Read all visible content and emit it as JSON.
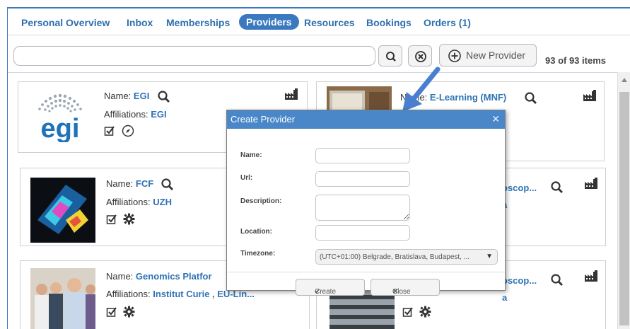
{
  "nav": {
    "tabs": [
      {
        "label": "Personal Overview"
      },
      {
        "label": "Inbox"
      },
      {
        "label": "Memberships"
      },
      {
        "label": "Providers"
      },
      {
        "label": "Resources"
      },
      {
        "label": "Bookings"
      },
      {
        "label": "Orders (1)"
      }
    ]
  },
  "toolbar": {
    "search_value": "",
    "new_provider_label": "New Provider",
    "items_count": "93 of 93 items",
    "icons": {
      "search": "search-icon",
      "clear": "clear-icon",
      "add": "plus-circle-icon"
    }
  },
  "cards": [
    {
      "name_label": "Name:",
      "name": "EGI",
      "affiliations_label": "Affiliations:",
      "affiliations": "EGI"
    },
    {
      "name_label": "Name:",
      "name": "E-Learning (MNF)"
    },
    {
      "name_label": "Name:",
      "name": "FCF",
      "affiliations_label": "Affiliations:",
      "affiliations": "UZH"
    },
    {
      "name_partial": "oscop...",
      "affiliations_partial": "a"
    },
    {
      "name_label": "Name:",
      "name": "Genomics Platfor",
      "affiliations_label": "Affiliations:",
      "affiliations": "Institut Curie , EU-Lin..."
    },
    {
      "name_partial": "oscop...",
      "affiliations_partial": "a"
    }
  ],
  "egi_logo_text": "egi",
  "modal": {
    "title": "Create Provider",
    "fields": {
      "name": {
        "label": "Name:",
        "value": ""
      },
      "url": {
        "label": "Url:",
        "value": ""
      },
      "description": {
        "label": "Description:",
        "value": ""
      },
      "location": {
        "label": "Location:",
        "value": ""
      },
      "timezone": {
        "label": "Timezone:",
        "value": "(UTC+01:00) Belgrade, Bratislava, Budapest, ..."
      }
    },
    "create_label": "Create",
    "close_label": "Close"
  },
  "colors": {
    "accent": "#3a79bf",
    "link": "#2f73b5",
    "modal_header": "#4a87c8",
    "arrow": "#4a7fd0"
  }
}
